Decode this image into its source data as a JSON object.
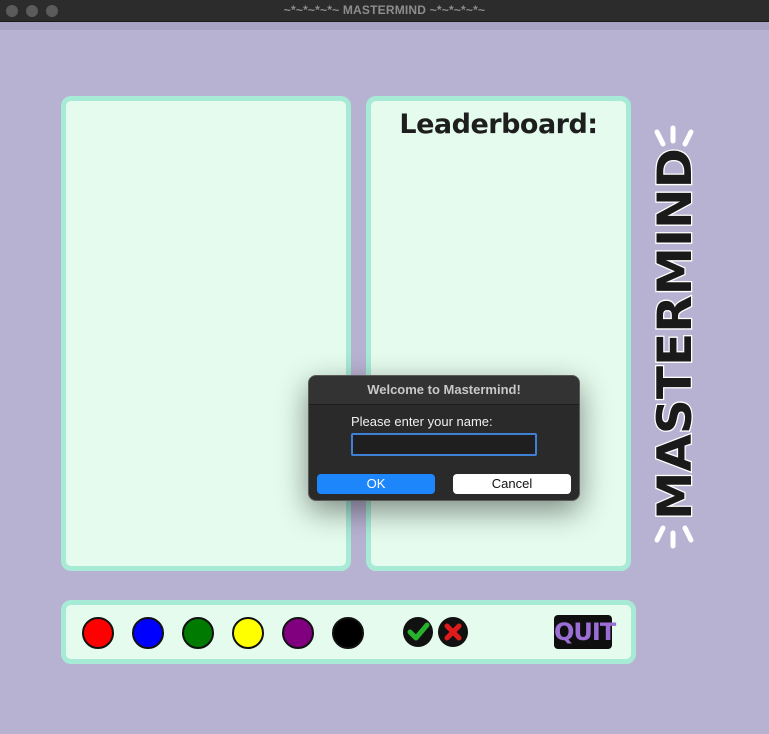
{
  "window": {
    "title": "~*~*~*~*~ MASTERMIND ~*~*~*~*~"
  },
  "leaderboard": {
    "title": "Leaderboard:"
  },
  "side_logo": {
    "text": "MASTERMIND"
  },
  "pegs": [
    {
      "name": "red",
      "color": "#ff0000"
    },
    {
      "name": "blue",
      "color": "#0000ff"
    },
    {
      "name": "green",
      "color": "#007a00"
    },
    {
      "name": "yellow",
      "color": "#ffff00"
    },
    {
      "name": "purple",
      "color": "#800080"
    },
    {
      "name": "black",
      "color": "#000000"
    }
  ],
  "controls": {
    "confirm_icon": "check-icon",
    "clear_icon": "x-icon",
    "quit_label": "QUIT"
  },
  "dialog": {
    "title": "Welcome to Mastermind!",
    "prompt": "Please enter your name:",
    "input_value": "",
    "ok_label": "OK",
    "cancel_label": "Cancel"
  },
  "colors": {
    "background": "#b8b2d2",
    "panel_fill": "#e4fbed",
    "panel_border": "#a7ead6",
    "ok_blue": "#1e86fb",
    "quit_purple": "#9b6ed6"
  }
}
